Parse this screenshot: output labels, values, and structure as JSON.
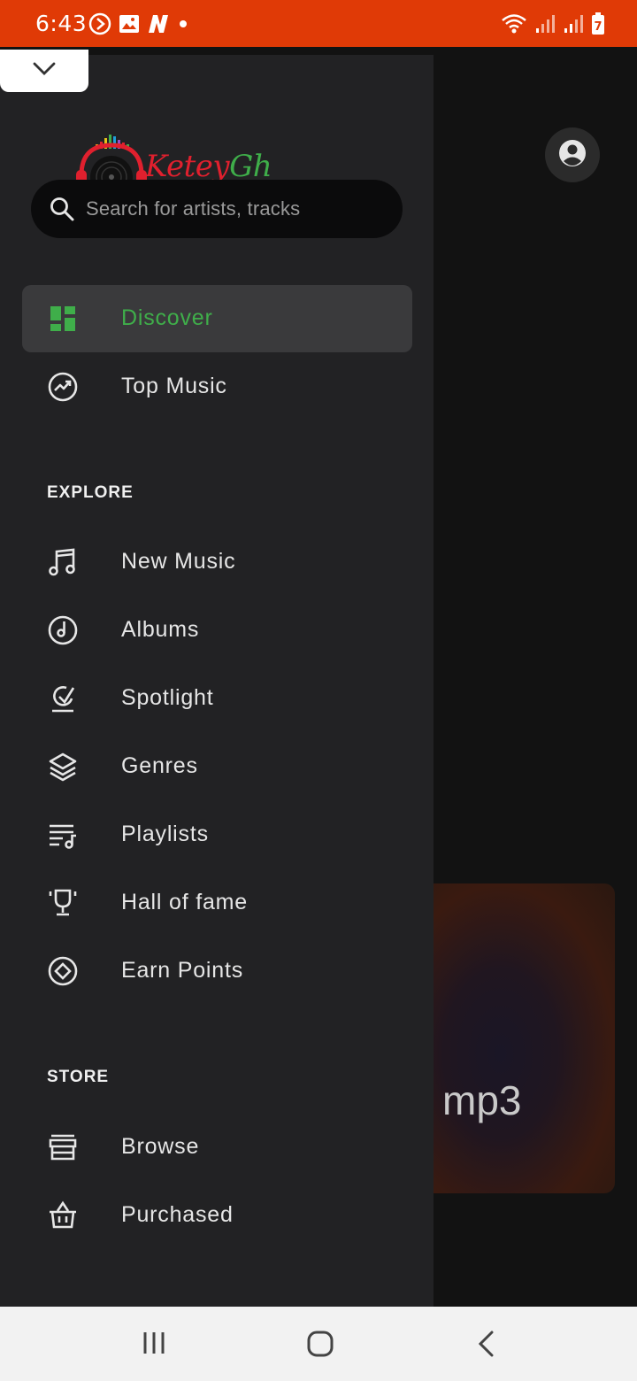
{
  "status_bar": {
    "time": "6:43",
    "background": "#e03a06",
    "left_icons": [
      "media-play-icon",
      "image-icon",
      "n-app-icon",
      "dot-icon"
    ],
    "right_icons": [
      "wifi-icon",
      "signal-icon",
      "signal-icon",
      "battery-icon"
    ],
    "battery_level": "7"
  },
  "drawer": {
    "brand": {
      "name_part1": "Ketey",
      "name_part2": "Gh",
      "colors": [
        "#e0202e",
        "#e6c21a",
        "#3fae4a"
      ]
    },
    "search": {
      "placeholder": "Search for artists, tracks"
    },
    "primary_items": [
      {
        "label": "Discover",
        "icon": "dashboard-icon",
        "active": true
      },
      {
        "label": "Top Music",
        "icon": "trending-icon",
        "active": false
      }
    ],
    "explore": {
      "title": "EXPLORE",
      "items": [
        {
          "label": "New Music",
          "icon": "music-note-icon"
        },
        {
          "label": "Albums",
          "icon": "album-icon"
        },
        {
          "label": "Spotlight",
          "icon": "spotlight-icon"
        },
        {
          "label": "Genres",
          "icon": "layers-icon"
        },
        {
          "label": "Playlists",
          "icon": "playlist-icon"
        },
        {
          "label": "Hall of fame",
          "icon": "trophy-icon"
        },
        {
          "label": "Earn Points",
          "icon": "points-icon"
        }
      ]
    },
    "store": {
      "title": "STORE",
      "items": [
        {
          "label": "Browse",
          "icon": "store-icon"
        },
        {
          "label": "Purchased",
          "icon": "basket-icon"
        }
      ]
    },
    "accent_color": "#3fae4a"
  },
  "background_app": {
    "card_text": "mp3"
  },
  "system_nav": [
    "recents-button",
    "home-button",
    "back-button"
  ]
}
